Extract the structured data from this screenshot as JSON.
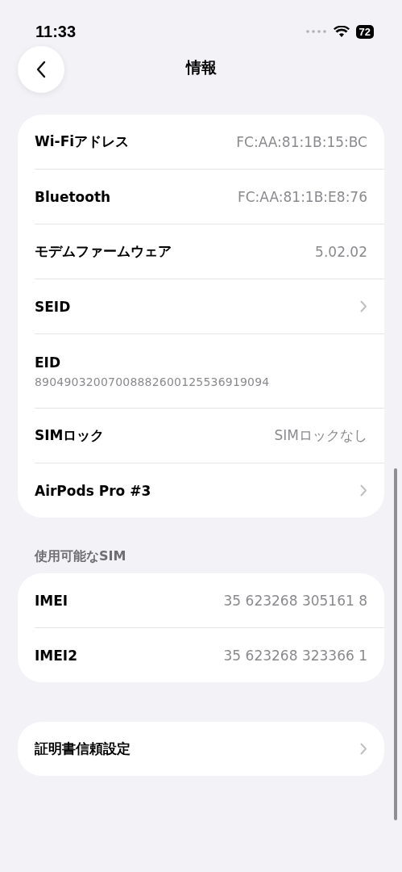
{
  "status_bar": {
    "time": "11:33",
    "battery": "72"
  },
  "nav": {
    "title": "情報"
  },
  "groups": [
    {
      "rows": [
        {
          "kind": "value",
          "label": "Wi-Fiアドレス",
          "value": "FC:AA:81:1B:15:BC"
        },
        {
          "kind": "value",
          "label": "Bluetooth",
          "value": "FC:AA:81:1B:E8:76"
        },
        {
          "kind": "value",
          "label": "モデムファームウェア",
          "value": "5.02.02"
        },
        {
          "kind": "chevron",
          "label": "SEID"
        },
        {
          "kind": "stacked",
          "label": "EID",
          "value": "89049032007008882600125536919094"
        },
        {
          "kind": "value",
          "label": "SIMロック",
          "value": "SIMロックなし"
        },
        {
          "kind": "chevron",
          "label": "AirPods Pro #3"
        }
      ]
    },
    {
      "header": "使用可能なSIM",
      "rows": [
        {
          "kind": "value",
          "label": "IMEI",
          "value": "35 623268 305161 8"
        },
        {
          "kind": "value",
          "label": "IMEI2",
          "value": "35 623268 323366 1"
        }
      ]
    },
    {
      "rows": [
        {
          "kind": "chevron",
          "label": "証明書信頼設定"
        }
      ]
    }
  ]
}
